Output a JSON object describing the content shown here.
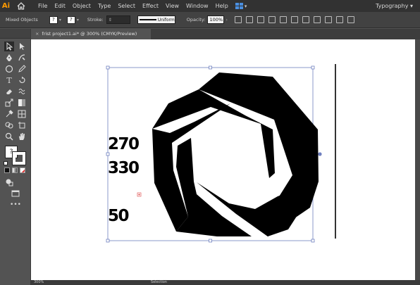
{
  "app": {
    "logo": "Ai",
    "menus": [
      "File",
      "Edit",
      "Object",
      "Type",
      "Select",
      "Effect",
      "View",
      "Window",
      "Help"
    ],
    "workspace": "Typography"
  },
  "control_bar": {
    "selection": "Mixed Objects",
    "stroke_label": "Stroke:",
    "stroke_value": "",
    "profile": "Uniform",
    "opacity_label": "Opacity:",
    "opacity_value": "100%"
  },
  "document": {
    "tab_title": "frist project1.ai* @ 300% (CMYK/Preview)",
    "close_glyph": "×"
  },
  "artwork": {
    "labels": [
      "270",
      "330",
      "50"
    ],
    "fill_color": "#000000",
    "selection_color": "#6f7fbf",
    "center_marker_color": "#e05a5a"
  },
  "status": {
    "zoom": "300%",
    "tool": "Selection"
  },
  "colors": {
    "chrome_dark": "#323232",
    "chrome_mid": "#424242",
    "panel": "#535353",
    "canvas": "#ffffff"
  },
  "tools": [
    "selection-tool",
    "direct-selection-tool",
    "pen-tool",
    "curvature-tool",
    "ellipse-tool",
    "pencil-tool",
    "type-tool",
    "rotate-tool",
    "eraser-tool",
    "warp-tool",
    "scale-tool",
    "gradient-tool",
    "eyedropper-tool",
    "mesh-tool",
    "shape-builder-tool",
    "artboard-tool",
    "zoom-tool",
    "hand-tool"
  ]
}
